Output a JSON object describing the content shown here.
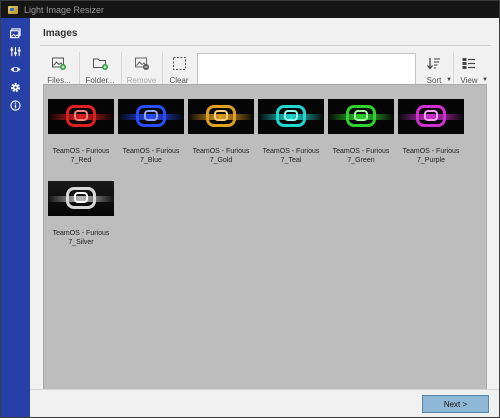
{
  "window": {
    "title": "Light Image Resizer"
  },
  "sidebar": {
    "items": [
      {
        "icon": "images-icon"
      },
      {
        "icon": "sliders-icon"
      },
      {
        "icon": "eye-icon"
      },
      {
        "icon": "gear-icon"
      },
      {
        "icon": "info-icon"
      }
    ]
  },
  "main": {
    "heading": "Images"
  },
  "toolbar": {
    "files_label": "Files...",
    "folder_label": "Folder...",
    "remove_label": "Remove",
    "clear_label": "Clear",
    "search_value": "",
    "sort_label": "Sort",
    "view_label": "View"
  },
  "images": [
    {
      "caption_line1": "TeamOS - Furious",
      "caption_line2": "7_Red",
      "color": "#e02020"
    },
    {
      "caption_line1": "TeamOS - Furious",
      "caption_line2": "7_Blue",
      "color": "#2a4cff"
    },
    {
      "caption_line1": "TeamOS - Furious",
      "caption_line2": "7_Gold",
      "color": "#e0a020"
    },
    {
      "caption_line1": "TeamOS - Furious",
      "caption_line2": "7_Teal",
      "color": "#20d8d0"
    },
    {
      "caption_line1": "TeamOS - Furious",
      "caption_line2": "7_Green",
      "color": "#30d030"
    },
    {
      "caption_line1": "TeamOS - Furious",
      "caption_line2": "7_Purple",
      "color": "#d030d0"
    },
    {
      "caption_line1": "TeamOS - Furious",
      "caption_line2": "7_Silver",
      "color": "#d8d8d8"
    }
  ],
  "footer": {
    "next_label": "Next >"
  }
}
